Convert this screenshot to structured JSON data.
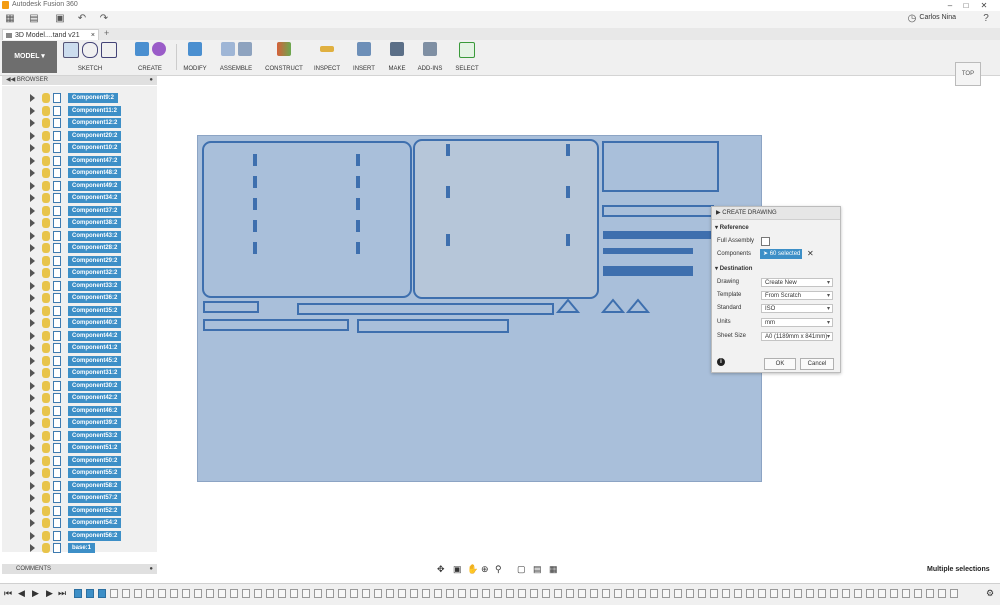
{
  "window": {
    "title": "Autodesk Fusion 360"
  },
  "quickaccess": {
    "user_name": "Carlos Nina"
  },
  "tabs": {
    "doc_title": "3D Model....tand v21"
  },
  "toolbar": {
    "workspace": "MODEL",
    "groups": [
      "SKETCH",
      "CREATE",
      "MODIFY",
      "ASSEMBLE",
      "CONSTRUCT",
      "INSPECT",
      "INSERT",
      "MAKE",
      "ADD-INS",
      "SELECT"
    ]
  },
  "viewcube": {
    "face": "TOP"
  },
  "browser": {
    "title": "BROWSER",
    "items": [
      "Component9:2",
      "Component11:2",
      "Component12:2",
      "Component20:2",
      "Component10:2",
      "Component47:2",
      "Component48:2",
      "Component49:2",
      "Component34:2",
      "Component37:2",
      "Component38:2",
      "Component43:2",
      "Component28:2",
      "Component29:2",
      "Component32:2",
      "Component33:2",
      "Component36:2",
      "Component35:2",
      "Component40:2",
      "Component44:2",
      "Component41:2",
      "Component45:2",
      "Component31:2",
      "Component30:2",
      "Component42:2",
      "Component46:2",
      "Component39:2",
      "Component53:2",
      "Component51:2",
      "Component50:2",
      "Component55:2",
      "Component58:2",
      "Component57:2",
      "Component52:2",
      "Component54:2",
      "Component56:2",
      "base:1"
    ]
  },
  "dialog": {
    "title": "CREATE DRAWING",
    "reference_label": "Reference",
    "full_assembly_label": "Full Assembly",
    "components_label": "Components",
    "components_value": "60 selected",
    "destination_label": "Destination",
    "drawing_label": "Drawing",
    "drawing_value": "Create New",
    "template_label": "Template",
    "template_value": "From Scratch",
    "standard_label": "Standard",
    "standard_value": "ISO",
    "units_label": "Units",
    "units_value": "mm",
    "sheet_size_label": "Sheet Size",
    "sheet_size_value": "A0 (1189mm x 841mm)",
    "ok_label": "OK",
    "cancel_label": "Cancel"
  },
  "comments": {
    "label": "COMMENTS"
  },
  "status": {
    "text": "Multiple selections"
  }
}
